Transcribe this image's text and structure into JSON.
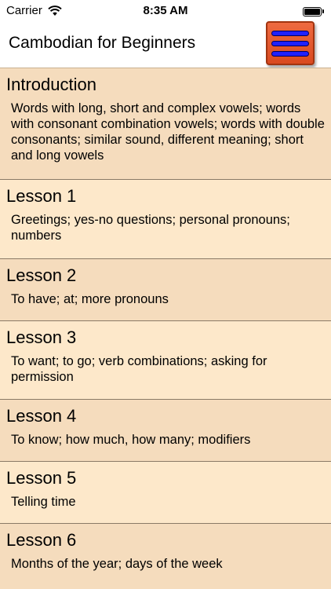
{
  "status_bar": {
    "carrier": "Carrier",
    "time": "8:35 AM",
    "battery_level": 1.0
  },
  "nav": {
    "title": "Cambodian for Beginners",
    "menu_icon": "hamburger-menu-icon"
  },
  "colors": {
    "row_odd": "#f5dcbd",
    "row_even": "#fde8ca",
    "menu_button": "#e35a30",
    "menu_bars": "#2020ff"
  },
  "lessons": [
    {
      "title": "Introduction",
      "description": "Words with long, short and complex vowels; words with consonant combination vowels; words with double consonants; similar sound, different meaning; short and long vowels"
    },
    {
      "title": "Lesson 1",
      "description": "Greetings; yes-no questions; personal pronouns; numbers"
    },
    {
      "title": "Lesson 2",
      "description": "To have; at; more pronouns"
    },
    {
      "title": "Lesson 3",
      "description": "To want; to go; verb combinations; asking for permission"
    },
    {
      "title": "Lesson 4",
      "description": "To know; how much, how many; modifiers"
    },
    {
      "title": "Lesson 5",
      "description": "Telling time"
    },
    {
      "title": "Lesson 6",
      "description": "Months of the year; days of the week"
    }
  ]
}
